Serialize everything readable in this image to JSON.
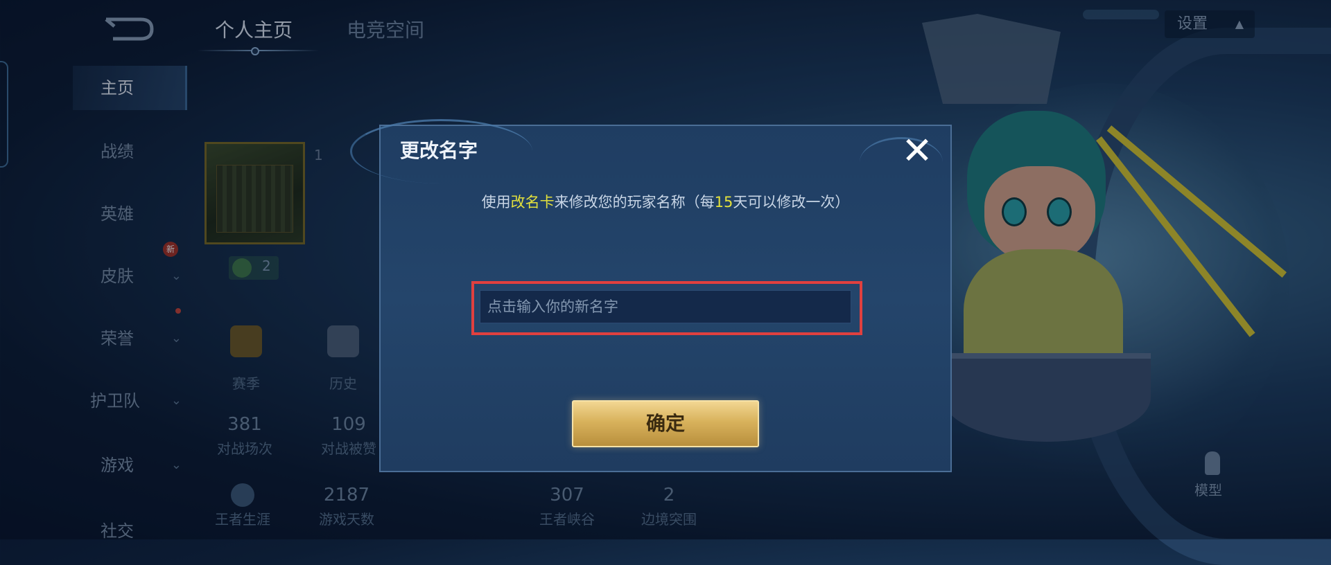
{
  "nav": {
    "tabs": [
      {
        "label": "个人主页",
        "active": true
      },
      {
        "label": "电竞空间",
        "active": false
      }
    ],
    "settings_label": "设置"
  },
  "sidebar": {
    "items": [
      {
        "label": "主页",
        "active": true
      },
      {
        "label": "战绩"
      },
      {
        "label": "英雄"
      },
      {
        "label": "皮肤",
        "badge": "新"
      },
      {
        "label": "荣誉"
      },
      {
        "label": "护卫队"
      },
      {
        "label": "游戏"
      },
      {
        "label": "社交"
      }
    ]
  },
  "profile": {
    "rank_fragment": "1",
    "level": "2",
    "stats_row1": [
      {
        "label": "赛季"
      },
      {
        "label": "历史"
      }
    ],
    "stats_row2": [
      {
        "value": "381",
        "label": "对战场次"
      },
      {
        "value": "109",
        "label": "对战被赞"
      }
    ],
    "stats_row3": [
      {
        "label": "王者生涯"
      },
      {
        "value": "2187",
        "label": "游戏天数"
      },
      {
        "value": "307",
        "label": "王者峡谷"
      },
      {
        "value": "2",
        "label": "边境突围"
      }
    ]
  },
  "model_label": "模型",
  "dialog": {
    "title": "更改名字",
    "close_icon": "close-icon",
    "desc_prefix": "使用",
    "desc_highlight_1": "改名卡",
    "desc_middle": "来修改您的玩家名称（每",
    "desc_highlight_2": "15",
    "desc_suffix": "天可以修改一次）",
    "input_placeholder": "点击输入你的新名字",
    "input_value": "",
    "confirm_label": "确定"
  },
  "colors": {
    "highlight": "#e4e13c",
    "input_outline": "#e0403f",
    "confirm_gold": "#d8b25c"
  }
}
